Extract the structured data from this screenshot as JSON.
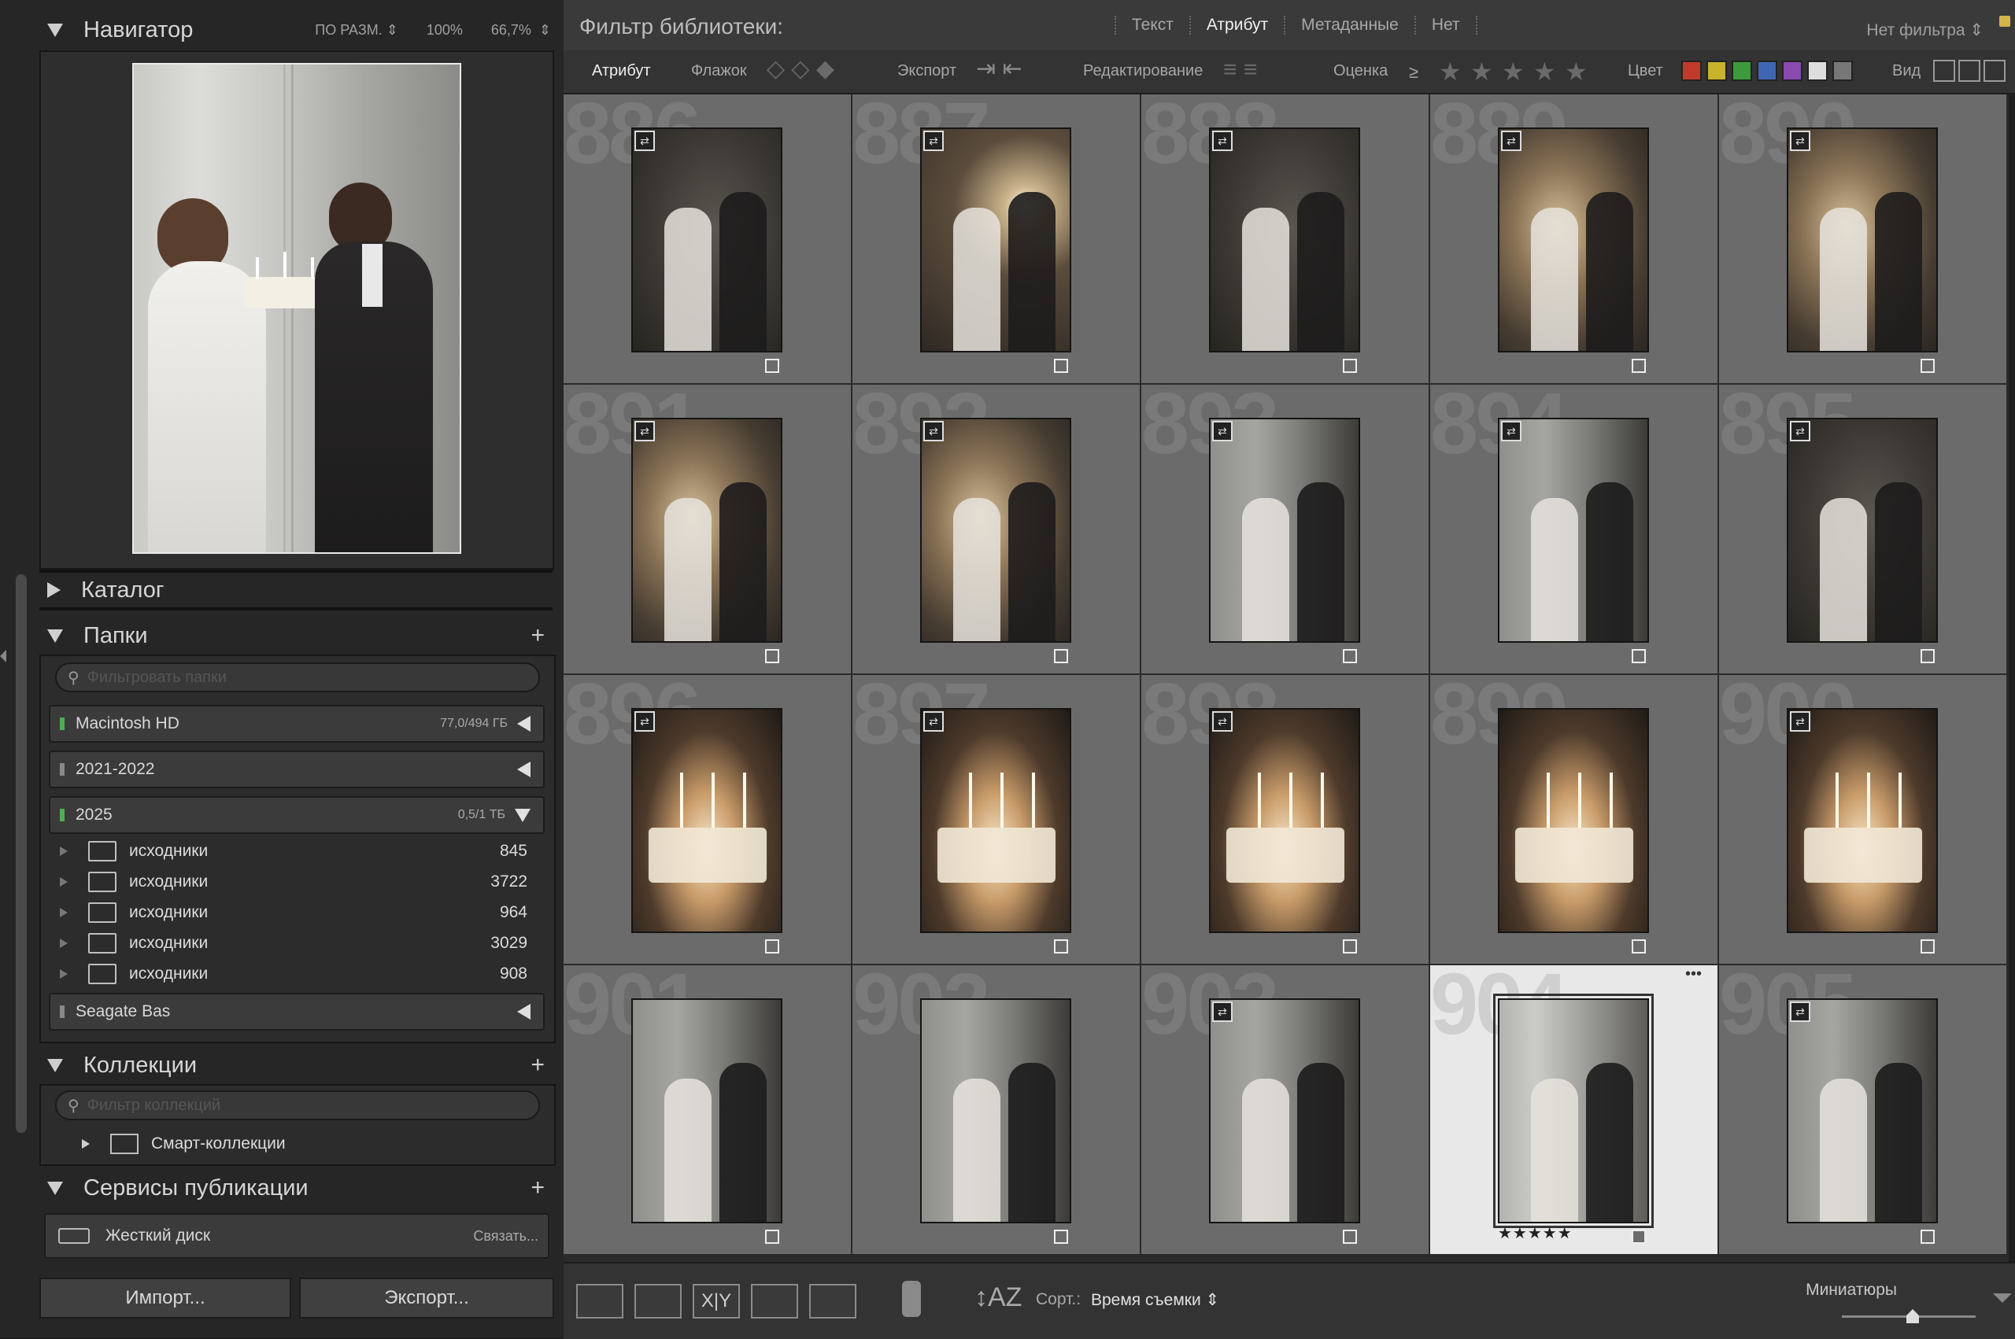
{
  "navigator": {
    "title": "Навигатор",
    "fit": "ПО РАЗМ.",
    "zoom1": "100%",
    "zoom2": "66,7%"
  },
  "catalog": {
    "title": "Каталог"
  },
  "folders": {
    "title": "Папки",
    "search_placeholder": "Фильтровать папки",
    "drives": [
      {
        "name": "Macintosh HD",
        "size": "77,0/494 ГБ",
        "led": "#4caf50"
      },
      {
        "name": "2021-2022",
        "size": "",
        "led": "#888888"
      },
      {
        "name": "2025",
        "size": "0,5/1 ТБ",
        "led": "#4caf50"
      }
    ],
    "items": [
      {
        "name": "исходники",
        "count": "845"
      },
      {
        "name": "исходники",
        "count": "3722"
      },
      {
        "name": "исходники",
        "count": "964"
      },
      {
        "name": "исходники",
        "count": "3029"
      },
      {
        "name": "исходники",
        "count": "908"
      }
    ],
    "last_drive": {
      "name": "Seagate Bas",
      "led": "#888888"
    }
  },
  "collections": {
    "title": "Коллекции",
    "search_placeholder": "Фильтр коллекций",
    "smart": "Смарт-коллекции"
  },
  "publish": {
    "title": "Сервисы публикации",
    "hd": "Жесткий диск",
    "link": "Связать..."
  },
  "buttons": {
    "import": "Импорт...",
    "export": "Экспорт..."
  },
  "filter": {
    "title": "Фильтр библиотеки:",
    "tabs": [
      "Текст",
      "Атрибут",
      "Метаданные",
      "Нет"
    ],
    "active_tab": "Атрибут",
    "preset": "Нет фильтра"
  },
  "attr": {
    "attribute": "Атрибут",
    "flag": "Флажок",
    "export": "Экспорт",
    "edit": "Редактирование",
    "rating": "Оценка",
    "gte": "≥",
    "color": "Цвет",
    "view": "Вид",
    "colors": [
      "#c0392b",
      "#c8b32d",
      "#3c9a3c",
      "#3f66b5",
      "#8a4ab0",
      "#dddddd",
      "#777777"
    ]
  },
  "grid": {
    "cells": [
      {
        "num": "886",
        "tone": "t-room",
        "badge": true
      },
      {
        "num": "887",
        "tone": "t-glow",
        "badge": true
      },
      {
        "num": "888",
        "tone": "t-room",
        "badge": true
      },
      {
        "num": "889",
        "tone": "t-blur",
        "badge": true
      },
      {
        "num": "890",
        "tone": "t-blur",
        "badge": true
      },
      {
        "num": "891",
        "tone": "t-blur",
        "badge": true
      },
      {
        "num": "892",
        "tone": "t-blur",
        "badge": true
      },
      {
        "num": "893",
        "tone": "t-door",
        "badge": true
      },
      {
        "num": "894",
        "tone": "t-door",
        "badge": true
      },
      {
        "num": "895",
        "tone": "t-room",
        "badge": true
      },
      {
        "num": "896",
        "tone": "t-cake",
        "badge": true
      },
      {
        "num": "897",
        "tone": "t-cake",
        "badge": true
      },
      {
        "num": "898",
        "tone": "t-cake",
        "badge": true
      },
      {
        "num": "899",
        "tone": "t-cake",
        "badge": false
      },
      {
        "num": "900",
        "tone": "t-cake",
        "badge": true
      },
      {
        "num": "901",
        "tone": "t-door",
        "badge": false
      },
      {
        "num": "902",
        "tone": "t-door",
        "badge": false
      },
      {
        "num": "903",
        "tone": "t-door",
        "badge": true
      },
      {
        "num": "904",
        "tone": "t-wide",
        "badge": false,
        "selected": true,
        "stars": "★★★★★"
      },
      {
        "num": "905",
        "tone": "t-door",
        "badge": true
      }
    ]
  },
  "toolbar": {
    "sort_label": "Сорт.:",
    "sort_value": "Время съемки",
    "thumbs": "Миниатюры"
  }
}
